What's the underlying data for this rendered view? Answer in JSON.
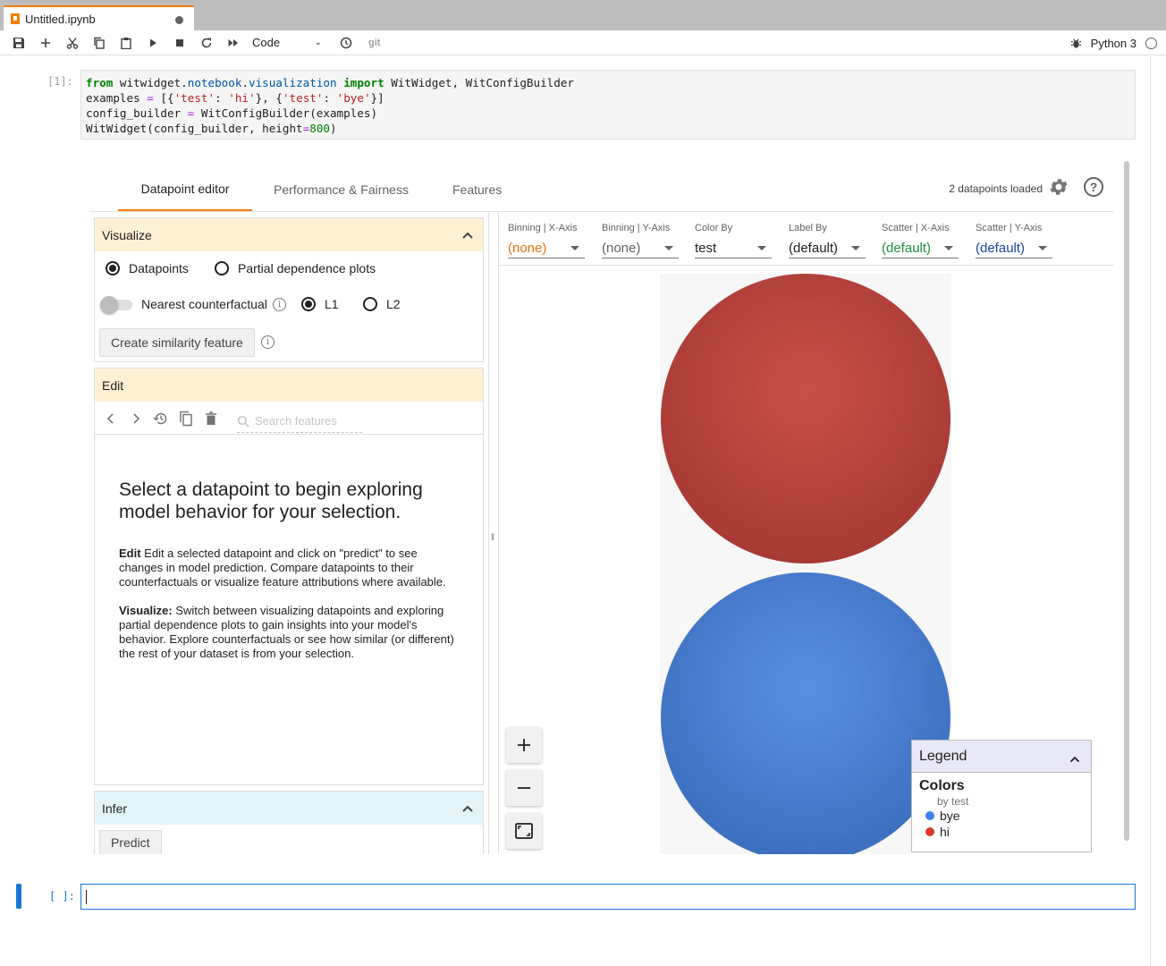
{
  "tab": {
    "title": "Untitled.ipynb"
  },
  "toolbar": {
    "cell_type": "Code",
    "git_label": "git",
    "kernel_name": "Python 3"
  },
  "cells": {
    "first_prompt": "[1]:",
    "code_lines": [
      "from witwidget.notebook.visualization import WitWidget, WitConfigBuilder",
      "examples = [{'test': 'hi'}, {'test': 'bye'}]",
      "config_builder = WitConfigBuilder(examples)",
      "WitWidget(config_builder, height=800)"
    ],
    "empty_prompt": "[ ]:"
  },
  "wit": {
    "tabs": [
      "Datapoint editor",
      "Performance & Fairness",
      "Features"
    ],
    "datapoints_loaded": "2 datapoints loaded",
    "help_icon": "?",
    "visualize": {
      "title": "Visualize",
      "opt_datapoints": "Datapoints",
      "opt_pdp": "Partial dependence plots",
      "nearest_cf": "Nearest counterfactual",
      "l1": "L1",
      "l2": "L2",
      "create_similarity": "Create similarity feature"
    },
    "edit": {
      "title": "Edit",
      "search_placeholder": "Search features",
      "heading": "Select a datapoint to begin exploring model behavior for your selection.",
      "p1_bold": "Edit",
      "p1": " Edit a selected datapoint and click on \"predict\" to see changes in model prediction. Compare datapoints to their counterfactuals or visualize feature attributions where available.",
      "p2_bold": "Visualize:",
      "p2": " Switch between visualizing datapoints and exploring partial dependence plots to gain insights into your model's behavior. Explore counterfactuals or see how similar (or different) the rest of your dataset is from your selection."
    },
    "infer": {
      "title": "Infer",
      "predict": "Predict"
    },
    "controls": [
      {
        "label": "Binning | X-Axis",
        "value": "(none)",
        "color": "#e8710a"
      },
      {
        "label": "Binning | Y-Axis",
        "value": "(none)",
        "color": "#5f6368"
      },
      {
        "label": "Color By",
        "value": "test",
        "color": "#212121"
      },
      {
        "label": "Label By",
        "value": "(default)",
        "color": "#212121"
      },
      {
        "label": "Scatter | X-Axis",
        "value": "(default)",
        "color": "#1e8e3e"
      },
      {
        "label": "Scatter | Y-Axis",
        "value": "(default)",
        "color": "#1a47a8"
      }
    ],
    "plot": {
      "points": [
        {
          "label": "hi",
          "color": "#c5463b"
        },
        {
          "label": "bye",
          "color": "#4a7fd0"
        }
      ]
    },
    "legend": {
      "title": "Legend",
      "section": "Colors",
      "subtitle": "by test",
      "items": [
        {
          "label": "bye",
          "color": "#3b82f0"
        },
        {
          "label": "hi",
          "color": "#d93a2b"
        }
      ]
    }
  }
}
